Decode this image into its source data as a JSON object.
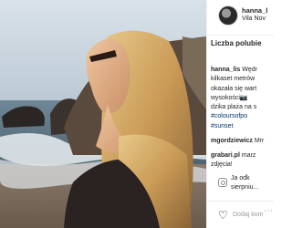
{
  "post": {
    "username": "hanna_l",
    "location": "Vila Nov",
    "likes_label": "Liczba polubie",
    "caption": {
      "user": "hanna_lis",
      "line1": "Wędr",
      "line2": "kilkaset metrów",
      "line3": "okazała się wart",
      "line4": "wysokości",
      "line5": "dzika plaża na s",
      "line6": "#colours",
      "line6b": "ofpo",
      "line7": "#sunset"
    },
    "comments": [
      {
        "user": "mgordziewicz",
        "text": "Mrr"
      },
      {
        "user": "grabari.pl",
        "text": "marz",
        "line2": "zdjęcia!"
      }
    ],
    "extra_line1": "Ja odk",
    "extra_line2": "sierpniu...",
    "add_comment_placeholder": "Dodaj kom"
  },
  "icons": [
    "heart-icon",
    "more-options-icon",
    "instagram-icon"
  ]
}
